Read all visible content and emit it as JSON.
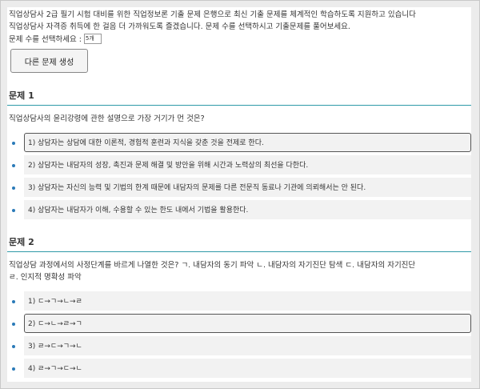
{
  "intro": {
    "line1": "직업상담사 2급 필기 시험 대비를 위한 직업정보론 기출 문제 은행으로 최신 기출 문제를 체계적인 학습하도록 지원하고 있습니다",
    "line2": "직업상담사 자격증 취득에 한 걸음 더 가까워도록 즐겠습니다. 문제 수를 선택하시고 기출문제를 풀어보세요."
  },
  "selector": {
    "label": "문제 수를 선택하세요 :",
    "value": "5개"
  },
  "generate_button": "다른 문제 생성",
  "problems": [
    {
      "heading": "문제 1",
      "question": "직업상담사의 윤리강령에 관한 설명으로 가장 거기가 먼 것은?",
      "options": [
        "1) 상담자는 상담에 대한 이론적, 경험적 훈련과 지식을 갖춘 것을 전제로 한다.",
        "2) 상담자는 내담자의 성장, 촉진과 문제 해결 및 방안을 위해 시간과 노력상의 최선을 다한다.",
        "3) 상담자는 자신의 능력 및 기법의 한계 때문에 내담자의 문제를 다른 전문직 동료나 기관에 의뢰해서는 안 된다.",
        "4) 상담자는 내담자가 이해, 수용할 수 있는 한도 내에서 기법을 활용한다."
      ],
      "selected_index": 0
    },
    {
      "heading": "문제 2",
      "question_line1": "직업상담 과정에서의 사정단계를 바르게 나열한 것은? ㄱ. 내담자의 동기 파악 ㄴ. 내담자의 자기진단 탐색 ㄷ. 내담자의 자기진단",
      "question_line2": "ㄹ. 인지적 명확성 파악",
      "options": [
        "1) ㄷ→ㄱ→ㄴ→ㄹ",
        "2) ㄷ→ㄴ→ㄹ→ㄱ",
        "3) ㄹ→ㄷ→ㄱ→ㄴ",
        "4) ㄹ→ㄱ→ㄷ→ㄴ"
      ],
      "selected_index": 1
    }
  ]
}
